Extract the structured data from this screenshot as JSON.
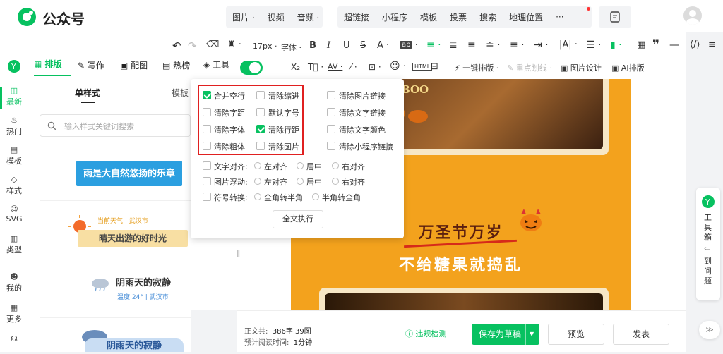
{
  "header": {
    "app_name": "公众号",
    "groups": [
      [
        "图片 ·",
        "视频",
        "音频 ·"
      ],
      [
        "超链接",
        "小程序",
        "模板",
        "投票",
        "搜索",
        "地理位置",
        "···"
      ]
    ]
  },
  "left_nav": [
    {
      "label": "最新",
      "icon": "new-icon"
    },
    {
      "label": "热门",
      "icon": "fire-icon"
    },
    {
      "label": "模板",
      "icon": "template-icon"
    },
    {
      "label": "样式",
      "icon": "style-icon"
    },
    {
      "label": "SVG",
      "icon": "svg-icon"
    },
    {
      "label": "类型",
      "icon": "type-icon"
    },
    {
      "label": "我的",
      "icon": "user-icon"
    },
    {
      "label": "更多",
      "icon": "more-icon"
    }
  ],
  "panel": {
    "tabs": [
      "排版",
      "写作",
      "配图",
      "热榜",
      "工具"
    ],
    "subtabs": [
      "单样式",
      "模板"
    ],
    "search_placeholder": "输入样式关键词搜索"
  },
  "styles": {
    "s1": "雨是大自然悠扬的乐章",
    "s2a": "当前天气",
    "s2b": "武汉市",
    "s2c": "晴天出游的好时光",
    "s3": "阴雨天的寂静",
    "s3b": "温度 24°",
    "s3c": "武汉市",
    "s4": "阴雨天的寂静"
  },
  "toolbar": {
    "font_size": "17px",
    "font": "字体",
    "one_click": "一键排版",
    "highlight": "重点划线",
    "img_design": "图片设计",
    "ai": "AI排版"
  },
  "dropdown": {
    "c1": [
      "合并空行",
      "清除字距",
      "清除字体",
      "清除粗体"
    ],
    "c2": [
      "清除缩进",
      "默认字号",
      "清除行距",
      "清除图片"
    ],
    "c3": [
      "清除图片链接",
      "清除文字链接",
      "清除文字颜色",
      "清除小程序链接"
    ],
    "checked": [
      "合并空行",
      "清除行距"
    ],
    "align_label": "文字对齐:",
    "align_opts": [
      "左对齐",
      "居中",
      "右对齐"
    ],
    "float_label": "图片浮动:",
    "float_opts": [
      "左对齐",
      "居中",
      "右对齐"
    ],
    "sym_label": "符号转换:",
    "sym_opts": [
      "全角转半角",
      "半角转全角"
    ],
    "execute": "全文执行",
    "accent": "#e02020"
  },
  "poster": {
    "title": "万圣节万岁",
    "subtitle": "不给糖果就捣乱",
    "boo": "BOO"
  },
  "bottom": {
    "word_label": "正文共:",
    "word_count": "386字 39图",
    "read_label": "预计阅读时间:",
    "read_time": "1分钟",
    "check": "违规检测",
    "save": "保存为草稿",
    "preview": "预览",
    "publish": "发表"
  },
  "right_tools": {
    "label": "工具箱",
    "q": "到问题"
  },
  "colors": {
    "brand": "#07c160",
    "orange": "#f3a21d"
  }
}
